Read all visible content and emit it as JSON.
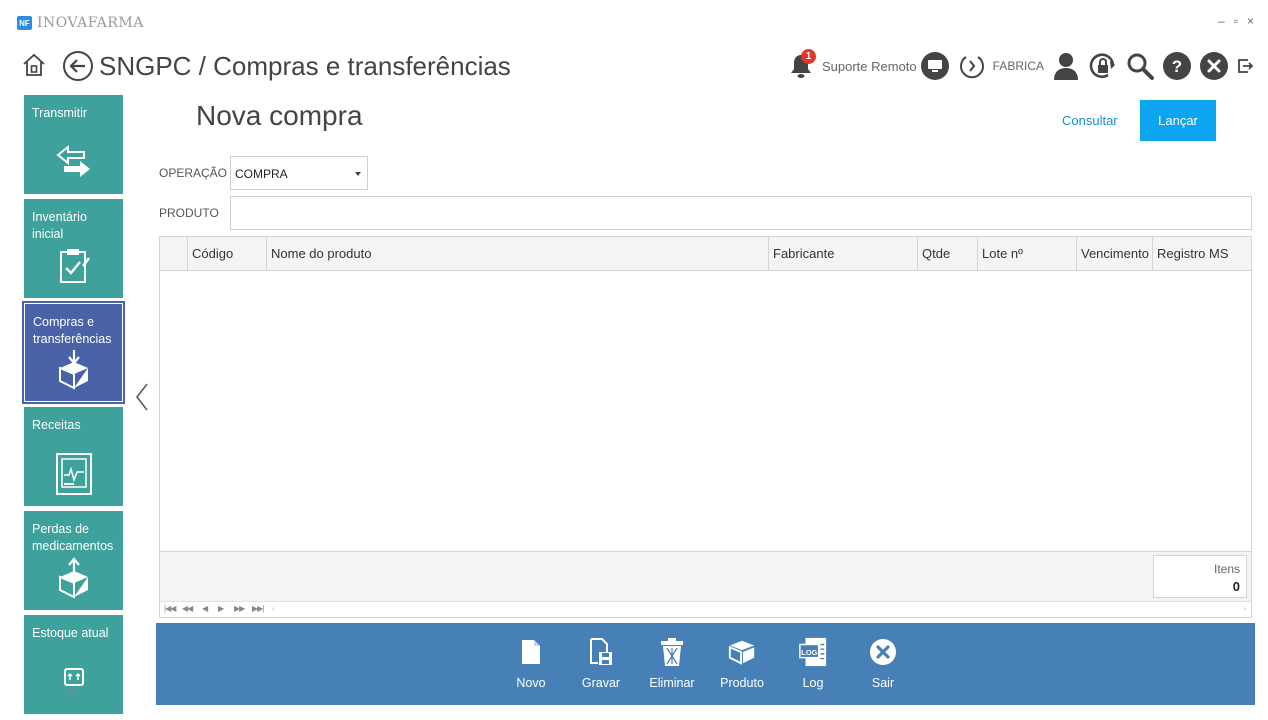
{
  "window": {
    "logo_text": "NF",
    "app_name": "INOVAFARMA",
    "controls": {
      "minimize": "–",
      "maximize": "▫",
      "close": "×"
    }
  },
  "header": {
    "title": "SNGPC / Compras e transferências",
    "notification_count": "1",
    "remote_support_label": "Suporte Remoto",
    "user_label": "FABRICA"
  },
  "sidebar": {
    "items": [
      {
        "label": "Transmitir",
        "icon": "transfer-arrows-icon"
      },
      {
        "label": "Inventário inicial",
        "icon": "clipboard-check-icon"
      },
      {
        "label": "Compras e transferências",
        "icon": "box-download-icon",
        "active": true
      },
      {
        "label": "Receitas",
        "icon": "prescription-chart-icon"
      },
      {
        "label": "Perdas de medicamentos",
        "icon": "box-upload-icon"
      },
      {
        "label": "Estoque atual",
        "icon": "stock-box-icon"
      }
    ]
  },
  "form": {
    "title": "Nova compra",
    "consultar_label": "Consultar",
    "lancar_label": "Lançar",
    "operacao_label": "OPERAÇÃO",
    "operacao_value": "COMPRA",
    "produto_label": "PRODUTO",
    "produto_value": ""
  },
  "grid": {
    "columns": [
      "Código",
      "Nome do produto",
      "Fabricante",
      "Qtde",
      "Lote nº",
      "Vencimento",
      "Registro MS"
    ],
    "rows": [],
    "itens_label": "Itens",
    "itens_count": "0"
  },
  "toolbar": {
    "buttons": [
      {
        "label": "Novo",
        "icon": "new-document-icon"
      },
      {
        "label": "Gravar",
        "icon": "save-icon"
      },
      {
        "label": "Eliminar",
        "icon": "trash-icon"
      },
      {
        "label": "Produto",
        "icon": "product-box-icon"
      },
      {
        "label": "Log",
        "icon": "log-icon"
      },
      {
        "label": "Sair",
        "icon": "exit-icon"
      }
    ]
  },
  "colors": {
    "sidebar_tile": "#3ea19c",
    "sidebar_active": "#4a63a8",
    "toolbar": "#4680b6",
    "primary_button": "#0ea5f0",
    "link": "#1d8fcf"
  }
}
